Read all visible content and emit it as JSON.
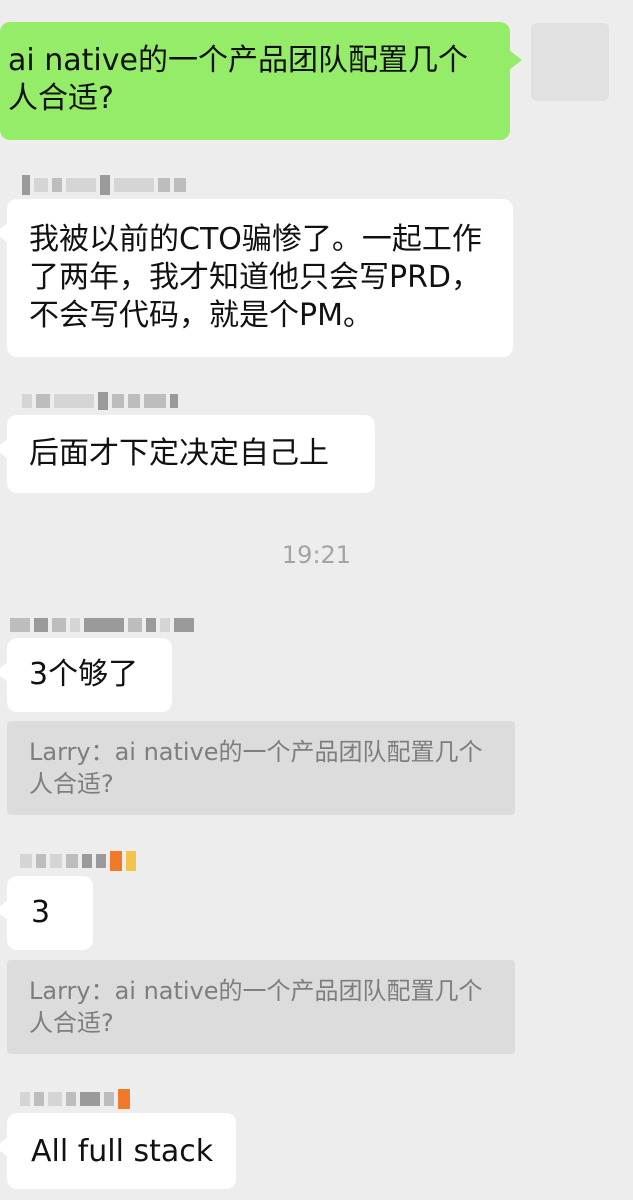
{
  "messages": {
    "m1_text": "ai native的一个产品团队配置几个人合适?",
    "m2_text": "我被以前的CTO骗惨了。一起工作了两年，我才知道他只会写PRD，不会写代码，就是个PM。",
    "m3_text": "后面才下定决定自己上",
    "m4_text": "3个够了",
    "m5_text": "3",
    "m6_text": "All full stack"
  },
  "timestamp": "19:21",
  "quotes": {
    "q1": "Larry：ai native的一个产品团队配置几个人合适?",
    "q2": "Larry：ai native的一个产品团队配置几个人合适?"
  },
  "colors": {
    "background": "#ededed",
    "outgoing_bubble": "#95ec69",
    "incoming_bubble": "#ffffff",
    "quote_bg": "#dcdcdc"
  }
}
